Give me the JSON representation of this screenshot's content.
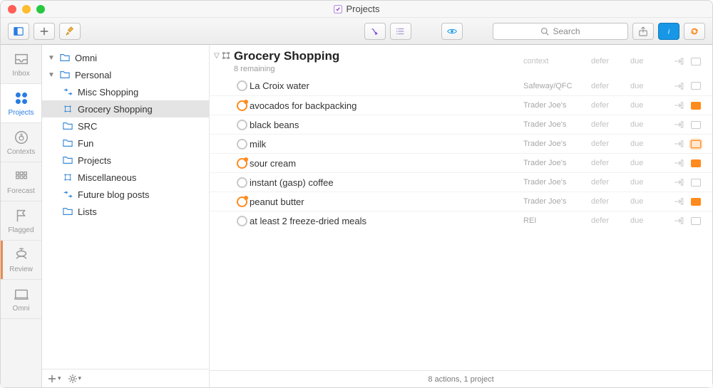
{
  "window": {
    "title": "Projects"
  },
  "toolbar": {
    "search_placeholder": "Search"
  },
  "rail": [
    {
      "id": "inbox",
      "label": "Inbox"
    },
    {
      "id": "projects",
      "label": "Projects"
    },
    {
      "id": "contexts",
      "label": "Contexts"
    },
    {
      "id": "forecast",
      "label": "Forecast"
    },
    {
      "id": "flagged",
      "label": "Flagged"
    },
    {
      "id": "review",
      "label": "Review"
    },
    {
      "id": "omni",
      "label": "Omni"
    }
  ],
  "sidebar": {
    "items": [
      {
        "label": "Omni",
        "depth": 0,
        "kind": "folder",
        "open": true
      },
      {
        "label": "Personal",
        "depth": 0,
        "kind": "folder",
        "open": true
      },
      {
        "label": "Misc Shopping",
        "depth": 1,
        "kind": "parallel"
      },
      {
        "label": "Grocery Shopping",
        "depth": 1,
        "kind": "single-action",
        "selected": true
      },
      {
        "label": "SRC",
        "depth": 1,
        "kind": "folder"
      },
      {
        "label": "Fun",
        "depth": 1,
        "kind": "folder"
      },
      {
        "label": "Projects",
        "depth": 1,
        "kind": "folder"
      },
      {
        "label": "Miscellaneous",
        "depth": 1,
        "kind": "single-action"
      },
      {
        "label": "Future blog posts",
        "depth": 1,
        "kind": "parallel"
      },
      {
        "label": "Lists",
        "depth": 1,
        "kind": "folder"
      }
    ]
  },
  "main": {
    "header": {
      "title": "Grocery Shopping",
      "subtitle": "8 remaining"
    },
    "column_placeholders": {
      "context": "context",
      "defer": "defer",
      "due": "due"
    },
    "tasks": [
      {
        "title": "La Croix water",
        "context": "Safeway/QFC",
        "defer": "defer",
        "due": "due",
        "flagged": false
      },
      {
        "title": "avocados for backpacking",
        "context": "Trader Joe's",
        "defer": "defer",
        "due": "due",
        "flagged": true
      },
      {
        "title": "black beans",
        "context": "Trader Joe's",
        "defer": "defer",
        "due": "due",
        "flagged": false
      },
      {
        "title": "milk",
        "context": "Trader Joe's",
        "defer": "defer",
        "due": "due",
        "flagged": false,
        "flag_highlight": true
      },
      {
        "title": "sour cream",
        "context": "Trader Joe's",
        "defer": "defer",
        "due": "due",
        "flagged": true
      },
      {
        "title": "instant (gasp) coffee",
        "context": "Trader Joe's",
        "defer": "defer",
        "due": "due",
        "flagged": false
      },
      {
        "title": "peanut butter",
        "context": "Trader Joe's",
        "defer": "defer",
        "due": "due",
        "flagged": true
      },
      {
        "title": "at least 2 freeze-dried meals",
        "context": "REI",
        "defer": "defer",
        "due": "due",
        "flagged": false
      }
    ]
  },
  "status": "8 actions, 1 project"
}
